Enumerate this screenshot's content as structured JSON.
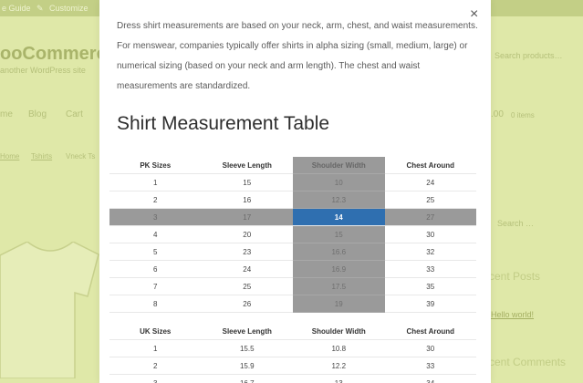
{
  "background": {
    "adminbar": {
      "item1": "e Guide",
      "item2": "Customize"
    },
    "site_title": "ooCommerc",
    "tagline": "another WordPress site",
    "nav": [
      "me",
      "Blog",
      "Cart"
    ],
    "breadcrumb": [
      "Home",
      "Tshirts",
      "Vneck Ts"
    ],
    "search_placeholder": "Search products…",
    "cart_amount": ".00",
    "cart_items": "0 items",
    "search2_placeholder": "Search …",
    "recent_posts": "cent Posts",
    "post_link": "Hello world!",
    "recent_comments": "cent Comments"
  },
  "modal": {
    "intro": "Dress shirt measurements are based on your neck, arm, chest, and waist measurements. For menswear, companies typically offer shirts in alpha sizing (small, medium, large) or numerical sizing (based on your neck and arm length). The chest and waist measurements are standardized.",
    "heading": "Shirt Measurement Table",
    "pk_table": {
      "headers": [
        "PK Sizes",
        "Sleeve Length",
        "Shoulder Width",
        "Chest Around"
      ],
      "rows": [
        [
          "1",
          "15",
          "10",
          "24"
        ],
        [
          "2",
          "16",
          "12.3",
          "25"
        ],
        [
          "3",
          "17",
          "14",
          "27"
        ],
        [
          "4",
          "20",
          "15",
          "30"
        ],
        [
          "5",
          "23",
          "16.6",
          "32"
        ],
        [
          "6",
          "24",
          "16.9",
          "33"
        ],
        [
          "7",
          "25",
          "17.5",
          "35"
        ],
        [
          "8",
          "26",
          "19",
          "39"
        ]
      ]
    },
    "uk_table": {
      "headers": [
        "UK Sizes",
        "Sleeve Length",
        "Shoulder Width",
        "Chest Around"
      ],
      "rows": [
        [
          "1",
          "15.5",
          "10.8",
          "30"
        ],
        [
          "2",
          "15.9",
          "12.2",
          "33"
        ],
        [
          "3",
          "16.7",
          "13",
          "34"
        ]
      ]
    }
  },
  "colors": {
    "highlight": "#2f6fb0",
    "highlight_band": "#9a9a9a",
    "backdrop": "#dfe8a8"
  }
}
